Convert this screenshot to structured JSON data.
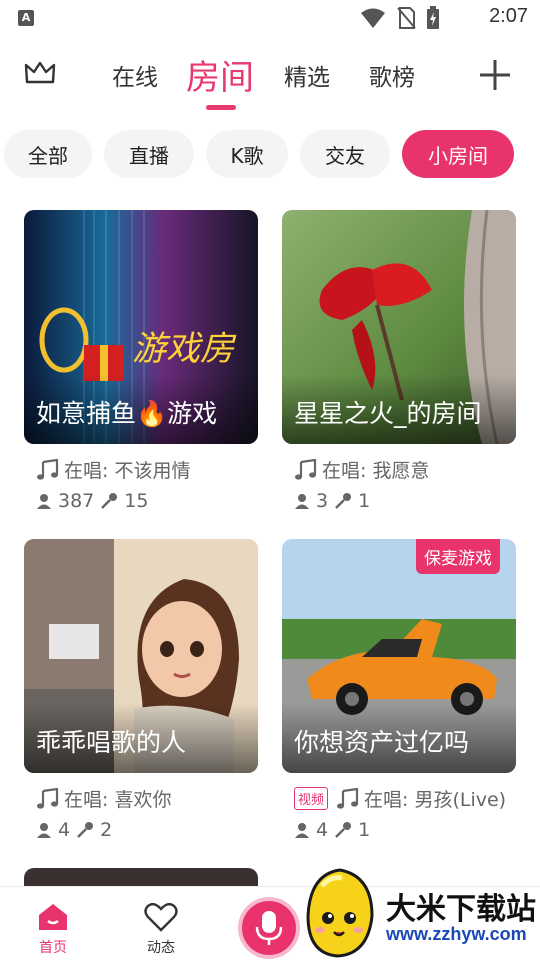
{
  "status_bar": {
    "time": "2:07"
  },
  "top_nav": {
    "tabs": [
      {
        "label": "在线"
      },
      {
        "label": "房间"
      },
      {
        "label": "精选"
      },
      {
        "label": "歌榜"
      }
    ]
  },
  "filters": {
    "chips": [
      {
        "label": "全部"
      },
      {
        "label": "直播"
      },
      {
        "label": "K歌"
      },
      {
        "label": "交友"
      },
      {
        "label": "小房间"
      }
    ]
  },
  "rooms": [
    {
      "title": "如意捕鱼🔥游戏",
      "singing": "在唱: 不该用情",
      "listeners": "387",
      "mics": "15"
    },
    {
      "title": "星星之火_的房间",
      "singing": "在唱: 我愿意",
      "listeners": "3",
      "mics": "1"
    },
    {
      "title": "乖乖唱歌的人",
      "singing": "在唱: 喜欢你",
      "listeners": "4",
      "mics": "2"
    },
    {
      "title": "你想资产过亿吗",
      "singing": "在唱: 男孩(Live)",
      "listeners": "4",
      "mics": "1",
      "badge": "保麦游戏",
      "tag": "视频"
    }
  ],
  "thumb_texts": {
    "game_logo": "游戏房"
  },
  "bottom_nav": {
    "home": "首页",
    "moments": "动态"
  },
  "watermark": {
    "name": "大米下载站",
    "url": "www.zzhyw.com"
  },
  "colors": {
    "accent": "#e8336d"
  }
}
